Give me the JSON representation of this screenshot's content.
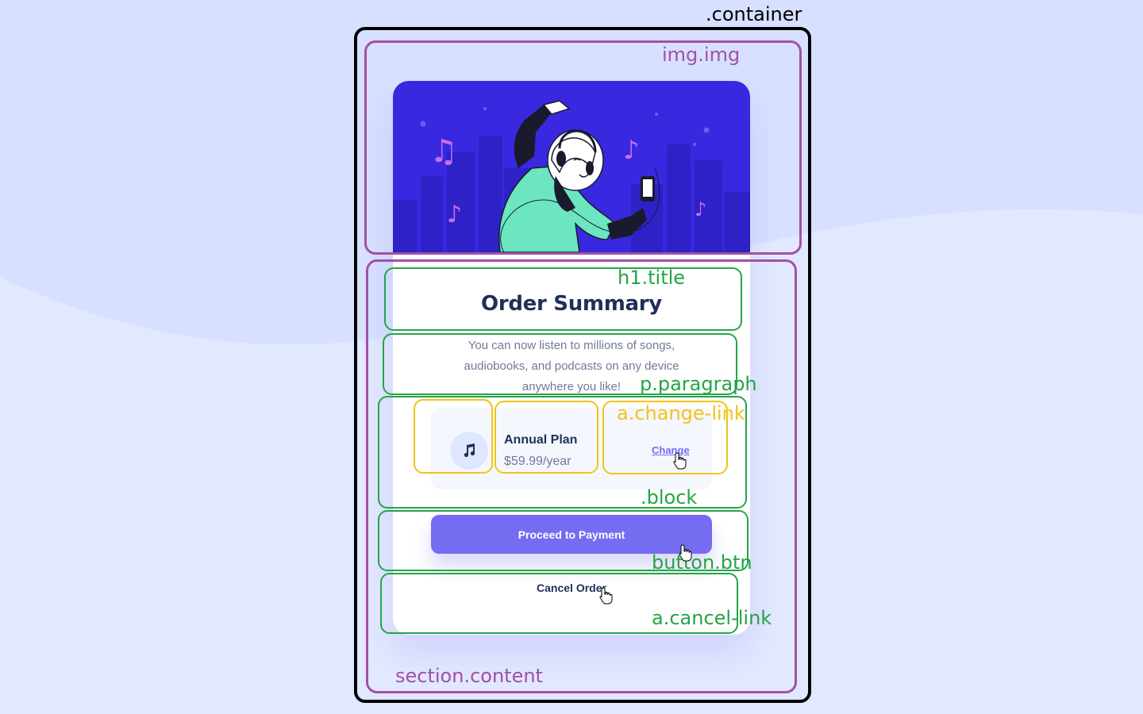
{
  "card": {
    "title": "Order Summary",
    "description": "You can now listen to millions of songs, audiobooks, and podcasts on any device anywhere you like!",
    "plan": {
      "icon": "music-note-icon",
      "name": "Annual Plan",
      "price": "$59.99/year",
      "change_label": "Change"
    },
    "proceed_label": "Proceed to Payment",
    "cancel_label": "Cancel Order"
  },
  "annotations": {
    "container": ".container",
    "img": "img.img",
    "title": "h1.title",
    "paragraph": "p.paragraph",
    "change_link": "a.change-link",
    "block": ".block",
    "button": "button.btn",
    "cancel_link": "a.cancel-link",
    "content": "section.content"
  },
  "colors": {
    "background": "#d7e0ff",
    "accent": "#766cf1",
    "hero": "#3829e0",
    "heading": "#1f2f56",
    "muted": "#6f7a99",
    "annotation_purple": "#a350a6",
    "annotation_green": "#24a545",
    "annotation_yellow": "#f0c419"
  }
}
